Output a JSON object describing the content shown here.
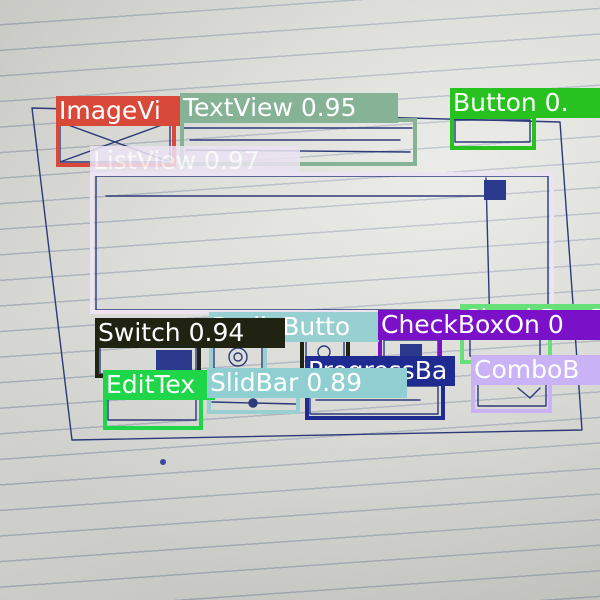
{
  "detections": [
    {
      "label": "ImageVi",
      "color": "#d9493a",
      "text_color": "#ffffff"
    },
    {
      "label": "TextView 0.95",
      "color": "#86b396",
      "text_color": "#ffffff"
    },
    {
      "label": "Button 0.",
      "color": "#27c21f",
      "text_color": "#ffffff"
    },
    {
      "label": "ListView 0.97",
      "color": "#ece4f3",
      "text_color": "#ffffff"
    },
    {
      "label": "Switch 0.94",
      "color": "#202312",
      "text_color": "#ffffff"
    },
    {
      "label": "RadioButto",
      "color": "#98cfd0",
      "text_color": "#ffffff"
    },
    {
      "label": "CheckBoxOn 0",
      "color": "#7a10c8",
      "text_color": "#ffffff"
    },
    {
      "label": "CheckBoxOn 0",
      "color": "#67e07a",
      "text_color": "#ffffff"
    },
    {
      "label": "ProgressBa",
      "color": "#1f2b90",
      "text_color": "#ffffff"
    },
    {
      "label": "ComboB",
      "color": "#c9b2f6",
      "text_color": "#ffffff"
    },
    {
      "label": "EditTex",
      "color": "#1ed648",
      "text_color": "#ffffff"
    },
    {
      "label": "SlidBar 0.89",
      "color": "#8fcfd2",
      "text_color": "#ffffff"
    }
  ]
}
